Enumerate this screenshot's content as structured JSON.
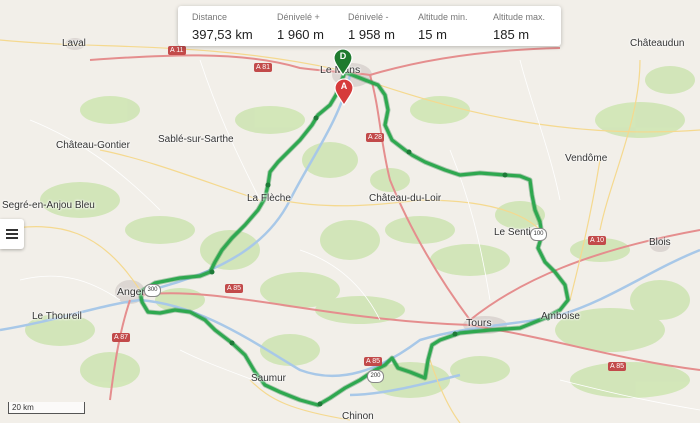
{
  "stats": [
    {
      "label": "Distance",
      "value": "397,53 km"
    },
    {
      "label": "Dénivelé +",
      "value": "1 960 m"
    },
    {
      "label": "Dénivelé -",
      "value": "1 958 m"
    },
    {
      "label": "Altitude min.",
      "value": "15 m"
    },
    {
      "label": "Altitude max.",
      "value": "185 m"
    }
  ],
  "places": {
    "laval": "Laval",
    "le_mans": "Le Mans",
    "chateaudun": "Châteaudun",
    "chateau_gontier": "Château-Gontier",
    "sable": "Sablé-sur-Sarthe",
    "vendome": "Vendôme",
    "segre": "Segré-en-Anjou Bleu",
    "la_fleche": "La Flèche",
    "chateau_du_loir": "Château-du-Loir",
    "le_sentier": "Le Sentier",
    "blois": "Blois",
    "angers": "Angers",
    "le_thoureil": "Le Thoureil",
    "tours": "Tours",
    "amboise": "Amboise",
    "saumur": "Saumur",
    "chinon": "Chinon"
  },
  "highways": {
    "a81": "A 81",
    "a28": "A 28",
    "a10": "A 10",
    "a85_w": "A 85",
    "a85_e": "A 85",
    "a85_s": "A 85",
    "a87": "A 87",
    "a11": "A 11"
  },
  "markers": {
    "start": "D",
    "end": "A"
  },
  "km_badges": [
    "100",
    "200",
    "300"
  ],
  "scale_label": "20 km",
  "colors": {
    "route": "#2ea84f",
    "route_outline": "#1e7a38",
    "start_marker": "#1f7a2e",
    "end_marker": "#d63b3b",
    "highway": "#c24a4a"
  }
}
